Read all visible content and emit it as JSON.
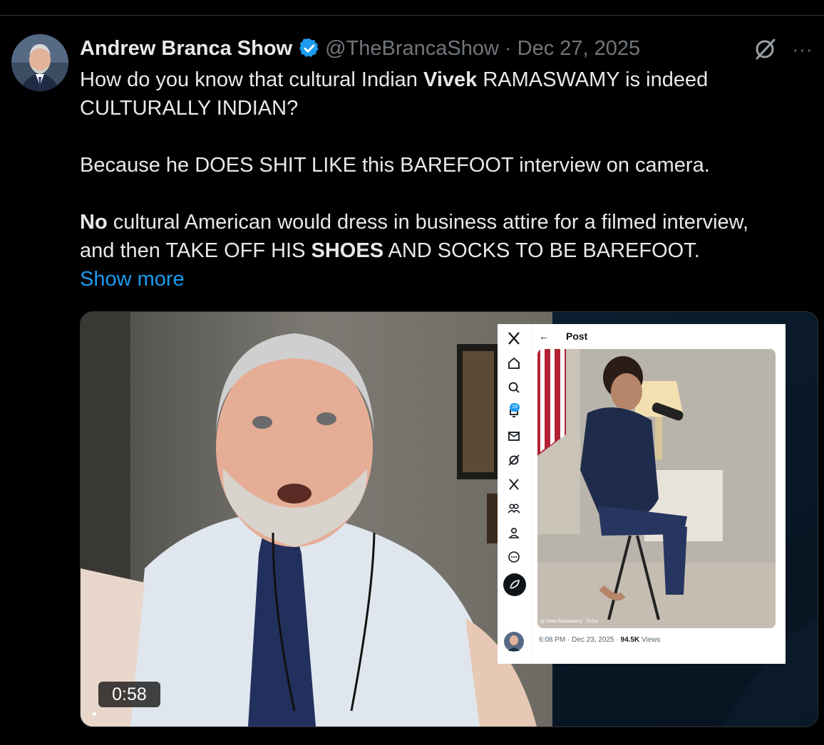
{
  "tweet": {
    "author_name": "Andrew Branca Show",
    "handle": "@TheBrancaShow",
    "separator": "·",
    "date": "Dec 27, 2025",
    "more_label": "···",
    "lines": {
      "l1_a": "How do you know that cultural Indian ",
      "l1_b": "Vivek",
      "l1_c": " RAMASWAMY is indeed",
      "l2": "CULTURALLY INDIAN?",
      "l3": "Because he DOES SHIT LIKE this BAREFOOT interview on camera.",
      "l4_a": "No",
      "l4_b": " cultural American would dress in business attire for a filmed interview,",
      "l5_a": "and then TAKE OFF HIS ",
      "l5_b": "SHOES",
      "l5_c": " AND SOCKS TO BE BAREFOOT."
    },
    "show_more": "Show more"
  },
  "video": {
    "duration": "0:58",
    "inner_screenshot": {
      "post_title": "Post",
      "back_arrow": "←",
      "notification_count": "19",
      "watermark": "@ Vivek Ramaswamy · TikTok",
      "timestamp": "6:08 PM · Dec 23, 2025 · ",
      "views_count": "94.5K",
      "views_label": " Views"
    }
  },
  "colors": {
    "background": "#000000",
    "text": "#e7e9ea",
    "secondary": "#71767b",
    "link": "#1d9bf0",
    "verified": "#1d9bf0"
  },
  "icons": [
    "verified-badge-icon",
    "grok-icon",
    "more-icon",
    "x-logo-icon",
    "home-icon",
    "search-icon",
    "bell-icon",
    "mail-icon",
    "grok-icon",
    "x-premium-icon",
    "communities-icon",
    "profile-icon",
    "more-circle-icon",
    "compose-icon"
  ]
}
